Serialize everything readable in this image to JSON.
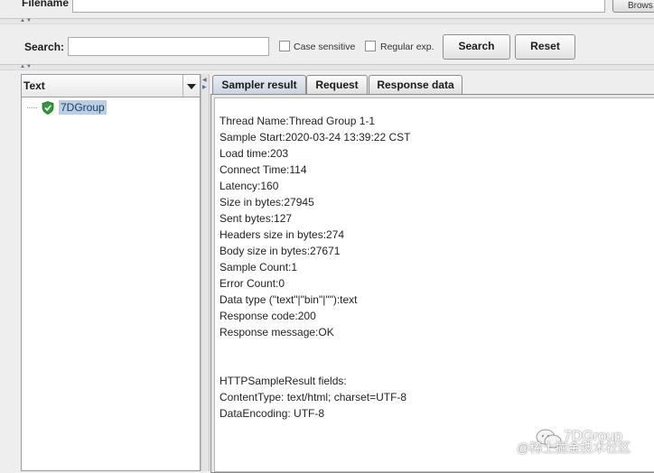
{
  "file_bar": {
    "filename_label": "Filename",
    "browse_label": "Brows"
  },
  "search": {
    "label": "Search:",
    "value": "",
    "case_sensitive_label": "Case sensitive",
    "regex_label": "Regular exp.",
    "search_button": "Search",
    "reset_button": "Reset"
  },
  "tree": {
    "header": "Text",
    "node": {
      "label": "7DGroup",
      "icon": "green-shield-check-icon"
    }
  },
  "tabs": [
    {
      "label": "Sampler result",
      "active": true
    },
    {
      "label": "Request",
      "active": false
    },
    {
      "label": "Response data",
      "active": false
    }
  ],
  "result": {
    "lines": [
      "Thread Name:Thread Group 1-1",
      "Sample Start:2020-03-24 13:39:22 CST",
      "Load time:203",
      "Connect Time:114",
      "Latency:160",
      "Size in bytes:27945",
      "Sent bytes:127",
      "Headers size in bytes:274",
      "Body size in bytes:27671",
      "Sample Count:1",
      "Error Count:0",
      "Data type (\"text\"|\"bin\"|\"\"):text",
      "Response code:200",
      "Response message:OK",
      "",
      "",
      "HTTPSampleResult fields:",
      "ContentType: text/html; charset=UTF-8",
      "DataEncoding: UTF-8"
    ]
  },
  "watermark": {
    "name": "7DGroup",
    "sub": "@稀土掘金技术社区",
    "icon": "wechat-icon"
  },
  "colors": {
    "selection": "#b8cfe5",
    "tab_active": "#c9d4e1",
    "icon_green": "#2e9b3a"
  }
}
